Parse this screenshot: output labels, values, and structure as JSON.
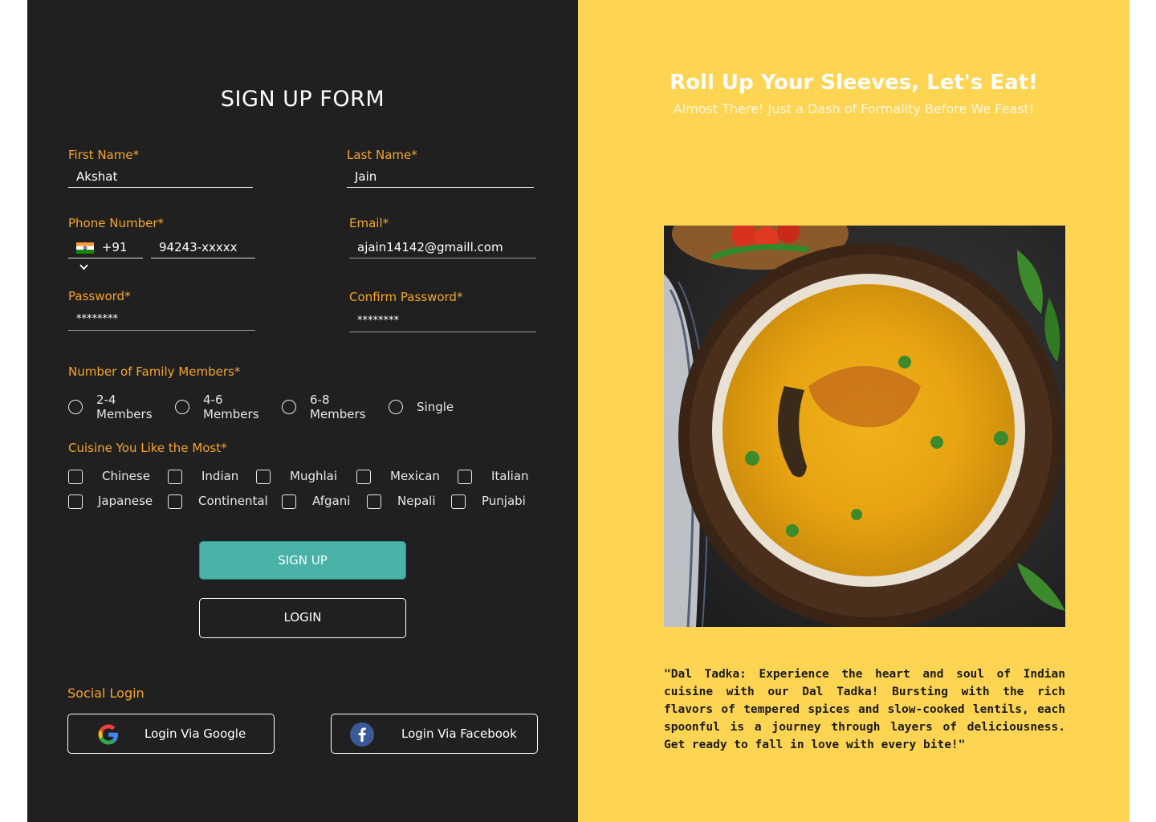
{
  "form": {
    "title": "SIGN UP FORM",
    "first_name": {
      "label": "First Name*",
      "value": "Akshat"
    },
    "last_name": {
      "label": "Last Name*",
      "value": "Jain"
    },
    "phone": {
      "label": "Phone Number*",
      "country_code": "+91",
      "value": "94243-xxxxx"
    },
    "email": {
      "label": "Email*",
      "value": "ajain14142@gmaill.com"
    },
    "password": {
      "label": "Password*",
      "value": "********"
    },
    "confirm_password": {
      "label": "Confirm Password*",
      "value": "********"
    },
    "family": {
      "label": "Number of Family Members*",
      "options": [
        "2-4 Members",
        "4-6 Members",
        "6-8 Members",
        "Single"
      ]
    },
    "cuisine": {
      "label": "Cuisine You Like the Most*",
      "row1": [
        "Chinese",
        "Indian",
        "Mughlai",
        "Mexican",
        "Italian"
      ],
      "row2": [
        "Japanese",
        "Continental",
        "Afgani",
        "Nepali",
        "Punjabi"
      ]
    },
    "signup_label": "SIGN UP",
    "login_label": "LOGIN",
    "social_label": "Social Login",
    "google_label": "Login Via Google",
    "facebook_label": "Login Via Facebook"
  },
  "hero": {
    "title": "Roll Up Your Sleeves, Let's Eat!",
    "subtitle": "Almost There! Just a Dash of Formality Before We Feast!",
    "image_name": "dal-tadka-bowl",
    "quote": "\"Dal Tadka: Experience the heart and soul of Indian cuisine with our Dal Tadka! Bursting with the rich flavors of tempered spices and slow-cooked lentils, each spoonful is a journey through layers of deliciousness. Get ready to fall in love with every bite!\""
  },
  "colors": {
    "left_bg": "#202020",
    "right_bg": "#fed453",
    "accent_label": "#f5a52a",
    "signup_button": "#49b3a8"
  }
}
